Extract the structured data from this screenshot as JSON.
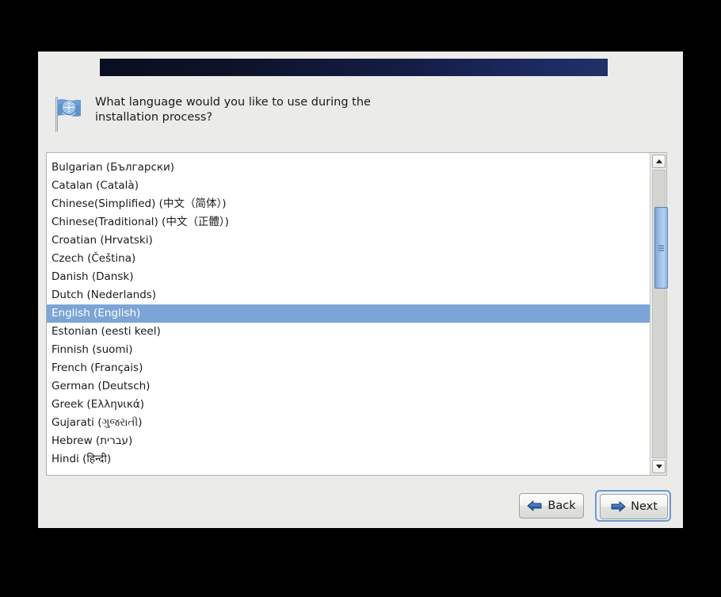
{
  "window": {
    "banner": {
      "name": "title-banner",
      "gradient_from": "#0a0e20",
      "gradient_to": "#203068"
    },
    "background_color": "#ebebe9"
  },
  "header": {
    "icon": "un-flag-icon",
    "question": "What language would you like to use during the\ninstallation process?"
  },
  "language_list": {
    "name": "language-listbox",
    "selected_index": 8,
    "selected_value": "English (English)",
    "selection_bg": "#7ba5d6",
    "items": [
      "Bulgarian (Български)",
      "Catalan (Català)",
      "Chinese(Simplified) (中文（简体）)",
      "Chinese(Traditional) (中文（正體）)",
      "Croatian (Hrvatski)",
      "Czech (Čeština)",
      "Danish (Dansk)",
      "Dutch (Nederlands)",
      "English (English)",
      "Estonian (eesti keel)",
      "Finnish (suomi)",
      "French (Français)",
      "German (Deutsch)",
      "Greek (Ελληνικά)",
      "Gujarati (ગુજરાતી)",
      "Hebrew (עברית)",
      "Hindi (हिन्दी)"
    ]
  },
  "scrollbar": {
    "up_arrow": "chevron-up-icon",
    "down_arrow": "chevron-down-icon",
    "thumb_color": "#9dc0e8"
  },
  "buttons": {
    "back": {
      "label": "Back",
      "icon": "arrow-left-icon"
    },
    "next": {
      "label": "Next",
      "icon": "arrow-right-icon",
      "focused": true,
      "focus_color": "#6d9ad0"
    }
  }
}
